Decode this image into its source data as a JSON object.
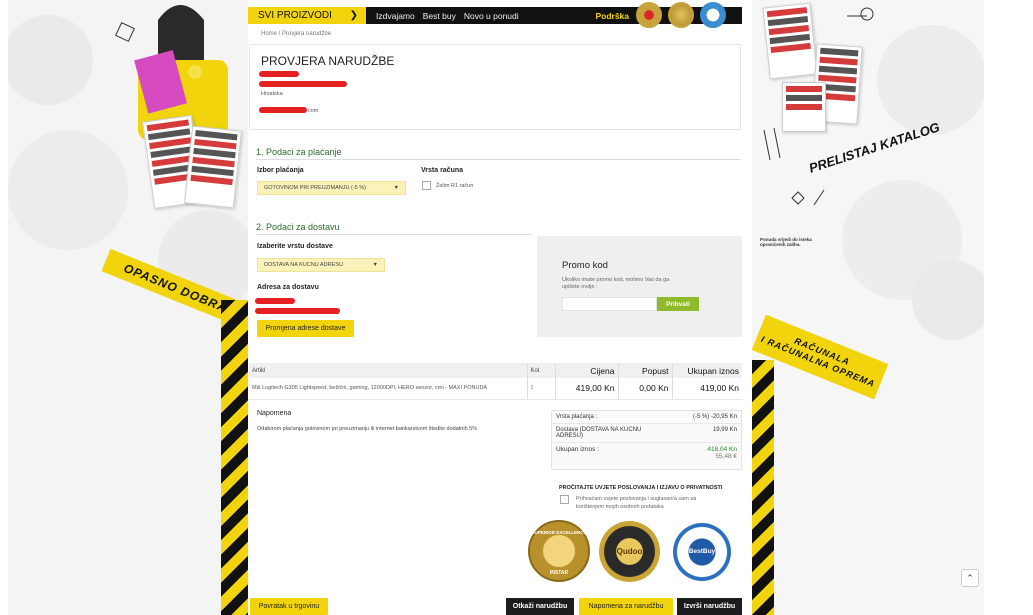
{
  "nav": {
    "category_button": "SVI PROIZVODI",
    "links": [
      "Izdvajamo",
      "Best buy",
      "Novo u ponudi"
    ],
    "support": "Podrška"
  },
  "breadcrumb": "Home  /  Provjera narudžbe",
  "address": {
    "title": "PROVJERA NARUDŽBE",
    "country": "Hrvatska",
    "email_suffix": "com"
  },
  "payment": {
    "section_title": "1. Podaci za plaćanje",
    "method_label": "Izbor plaćanja",
    "method_value": "GOTOVINOM PRI PREUZIMANJU  (-5 %)",
    "invoice_label": "Vrsta računa",
    "invoice_checkbox": "Želim R1 račun"
  },
  "delivery": {
    "section_title": "2. Podaci za dostavu",
    "type_label": "Izaberite vrstu dostave",
    "type_value": "DOSTAVA NA KUCNU ADRESU",
    "address_label": "Adresa za dostavu",
    "change_button": "Promjena adrese dostave"
  },
  "promo": {
    "title": "Promo kod",
    "description": "Ukoliko imate promo kod, molimo Vas da ga upišete ovdje :",
    "input_value": "",
    "apply_button": "Prihvati"
  },
  "table": {
    "headers": [
      "Artikl",
      "Kol.",
      "Cijena",
      "Popust",
      "Ukupan iznos"
    ],
    "rows": [
      {
        "article": "Miš Logitech G305 Lightspeed, bežični, gaming, 12000DPI, HERO senzor, crni - MAXI PONUDA",
        "qty": "1",
        "price": "419,00 Kn",
        "discount": "0,00 Kn",
        "total": "419,00 Kn"
      }
    ]
  },
  "note": {
    "title": "Napomena",
    "text": "Odabirom plaćanja gotovinom pri preuzimanju ili internet bankarstvom štedite dodatnih 5%"
  },
  "summary": {
    "payment_type_label": "Vrsta plaćanja :",
    "payment_type_value": "(-5 %) -20,95 Kn",
    "delivery_label": "Dostava  (DOSTAVA NA KUCNU ADRESU)",
    "delivery_value": "19,99 Kn",
    "total_label": "Ukupan iznos :",
    "total_kn": "418,04 Kn",
    "total_eur": "55,48 €"
  },
  "terms": {
    "heading": "PROČITAJTE UVJETE POSLOVANJA I IZJAVU O PRIVATNOSTI",
    "checkbox_text": "Prihvaćam uvjete poslovanja i suglasan/a sam sa korištenjem mojih osobnih podataka"
  },
  "seals": {
    "first_ring": "SUPERIOR EXCELLENCE",
    "first_bottom": "INSTAR",
    "second": "Qudoo",
    "third": "BestBuy"
  },
  "buttons": {
    "back": "Povratak u trgovinu",
    "cancel": "Otkaži narudžbu",
    "note": "Napomena za narudžbu",
    "submit": "Izvrši narudžbu"
  },
  "left_banner": {
    "tape": "OPASNO DOBRA"
  },
  "right_banner": {
    "catalog_text": "PRELISTAJ KATALOG",
    "fine_print": "Ponuda vrijedi do isteka opranićenih zaliha.",
    "tape_line1": "RAČUNALA",
    "tape_line2": "I RAČUNALNA OPREMA"
  },
  "colors": {
    "brand_yellow": "#f2d40c",
    "dark": "#111111",
    "green_title": "#2a6e2a",
    "promo_green": "#8fba2c",
    "redaction": "#e52020"
  }
}
